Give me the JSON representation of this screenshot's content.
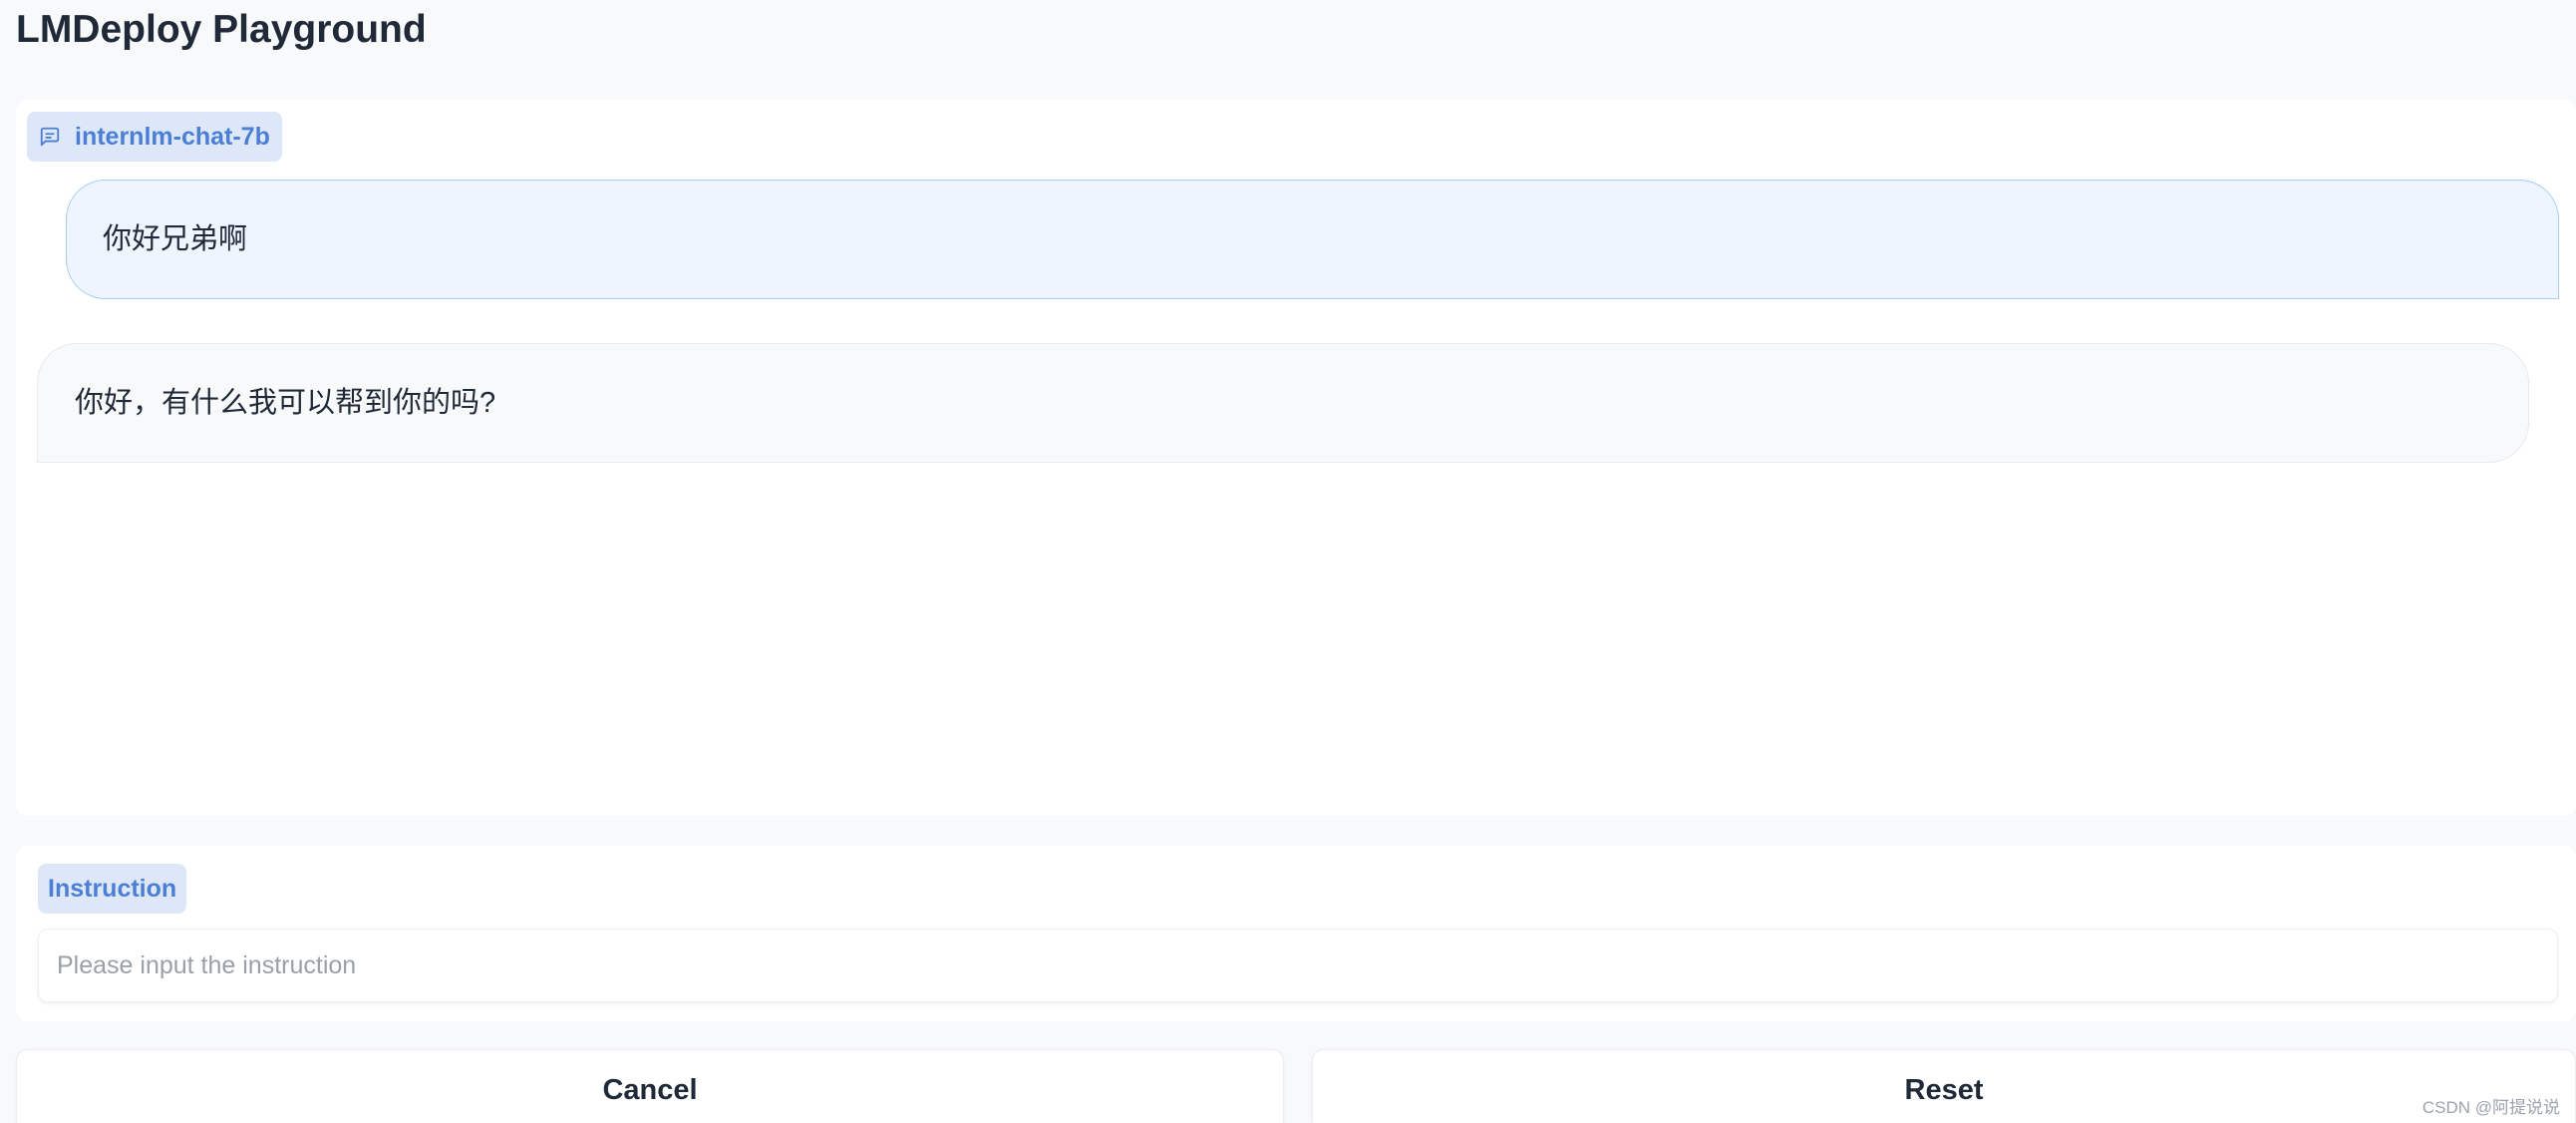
{
  "app": {
    "title": "LMDeploy Playground"
  },
  "chatbot": {
    "model_label": "internlm-chat-7b",
    "model_icon": "chat-bubble-icon",
    "messages": [
      {
        "role": "user",
        "text": "你好兄弟啊"
      },
      {
        "role": "assistant",
        "text": "你好，有什么我可以帮到你的吗?"
      }
    ]
  },
  "instruction": {
    "label": "Instruction",
    "value": "",
    "placeholder": "Please input the instruction"
  },
  "buttons": {
    "cancel_label": "Cancel",
    "reset_label": "Reset"
  },
  "watermark": {
    "text": "CSDN @阿提说说"
  },
  "colors": {
    "accent": "#4b7fd6",
    "label_bg": "#dde7f8",
    "user_bubble_bg": "#eef5ff",
    "user_bubble_border": "#a9cdf5",
    "bot_bubble_bg": "#f8f9fb"
  }
}
